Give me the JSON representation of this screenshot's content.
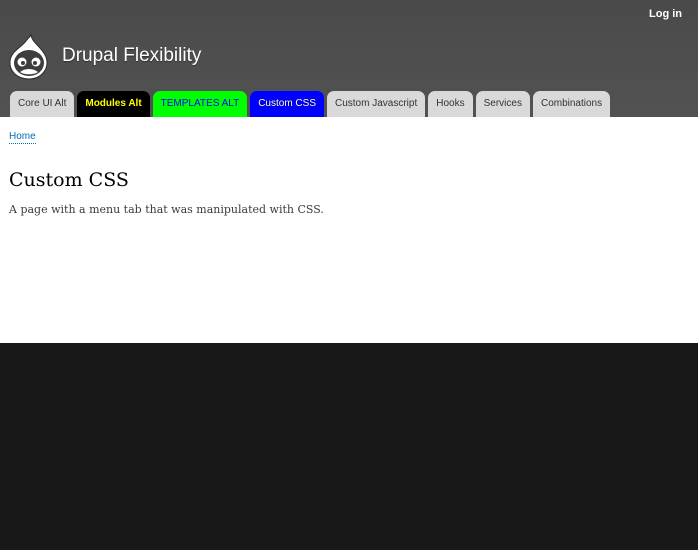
{
  "header": {
    "login_label": "Log in",
    "site_name": "Drupal Flexibility",
    "logo_icon": "drupal-drop-icon",
    "background_color": "#4d4d4d"
  },
  "nav": {
    "tabs": [
      {
        "label": "Core UI Alt",
        "bg": "#d9d9d9",
        "color": "#333333"
      },
      {
        "label": "Modules Alt",
        "bg": "#000000",
        "color": "#ffff00"
      },
      {
        "label": "TEMPLATES ALT",
        "bg": "#00ff00",
        "color": "#0000ff"
      },
      {
        "label": "Custom CSS",
        "bg": "#0000ff",
        "color": "#ffffff"
      },
      {
        "label": "Custom Javascript",
        "bg": "#d9d9d9",
        "color": "#333333"
      },
      {
        "label": "Hooks",
        "bg": "#d9d9d9",
        "color": "#333333"
      },
      {
        "label": "Services",
        "bg": "#d9d9d9",
        "color": "#333333"
      },
      {
        "label": "Combinations",
        "bg": "#d9d9d9",
        "color": "#333333"
      }
    ]
  },
  "main": {
    "breadcrumb": "Home",
    "title": "Custom CSS",
    "body": "A page with a menu tab that was manipulated with CSS.",
    "link_color": "#0071b3"
  },
  "footer": {
    "background_color": "#181818"
  }
}
